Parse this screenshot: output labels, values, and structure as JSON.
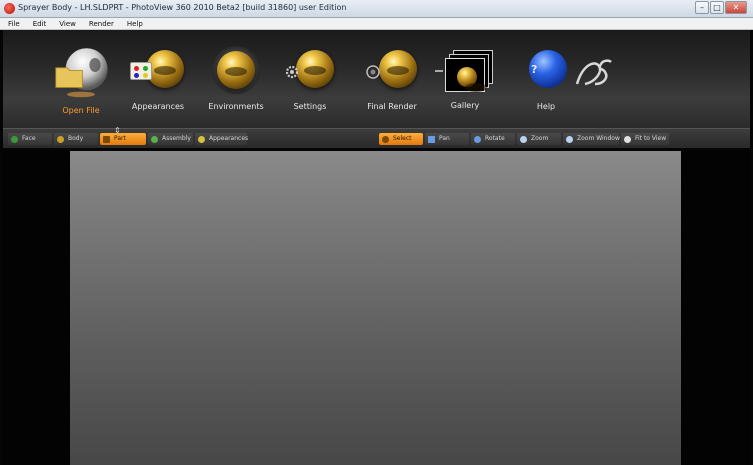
{
  "window": {
    "title": "Sprayer Body - LH.SLDPRT - PhotoView 360 2010 Beta2 [build 31860] user Edition",
    "minimize": "–",
    "maximize": "□",
    "close": "✕"
  },
  "menu": [
    "File",
    "Edit",
    "View",
    "Render",
    "Help"
  ],
  "tools": [
    {
      "label": "Open File",
      "icon": "open-file-icon",
      "active": true
    },
    {
      "label": "Appearances",
      "icon": "appearances-icon"
    },
    {
      "label": "Environments",
      "icon": "environments-icon"
    },
    {
      "label": "Settings",
      "icon": "settings-icon"
    },
    {
      "label": "Final Render",
      "icon": "final-render-icon"
    },
    {
      "label": "Gallery",
      "icon": "gallery-icon"
    },
    {
      "label": "Help",
      "icon": "help-icon"
    }
  ],
  "filters": [
    {
      "label": "Face",
      "icon": "face-icon"
    },
    {
      "label": "Body",
      "icon": "body-icon"
    },
    {
      "label": "Part",
      "icon": "part-icon",
      "active": true
    },
    {
      "label": "Assembly",
      "icon": "assembly-icon"
    },
    {
      "label": "Appearances",
      "icon": "appearances-small-icon"
    }
  ],
  "view_tools": [
    {
      "label": "Select",
      "icon": "select-icon",
      "active": true
    },
    {
      "label": "Pan",
      "icon": "pan-icon"
    },
    {
      "label": "Rotate",
      "icon": "rotate-icon"
    },
    {
      "label": "Zoom",
      "icon": "zoom-icon"
    },
    {
      "label": "Zoom Window",
      "icon": "zoom-window-icon"
    },
    {
      "label": "Fit to View",
      "icon": "fit-to-view-icon"
    }
  ],
  "colors": {
    "accent": "#ff9a2e",
    "toolbar_bg": "#2a2a2a",
    "viewport_top": "#8a8a8a",
    "viewport_bottom": "#474747"
  }
}
